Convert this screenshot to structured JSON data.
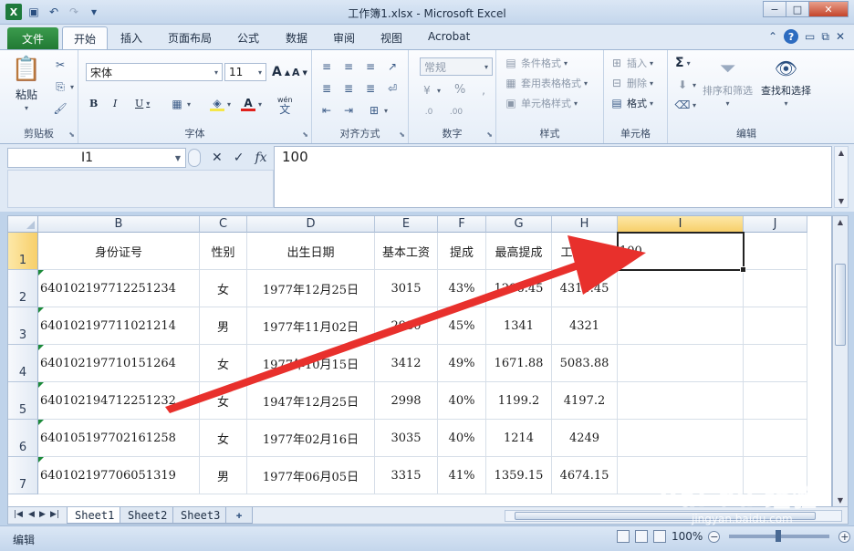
{
  "window": {
    "title": "工作簿1.xlsx - Microsoft Excel",
    "min": "−",
    "max": "□",
    "close": "✕"
  },
  "tabs": {
    "file": "文件",
    "items": [
      "开始",
      "插入",
      "页面布局",
      "公式",
      "数据",
      "审阅",
      "视图",
      "Acrobat"
    ],
    "active": "开始"
  },
  "ribbon": {
    "clipboard": {
      "paste": "粘贴",
      "label": "剪贴板"
    },
    "font": {
      "name": "宋体",
      "size": "11",
      "grow": "A",
      "shrink": "A",
      "bold": "B",
      "italic": "I",
      "underline": "U",
      "wen": "wén",
      "label": "字体"
    },
    "alignment": {
      "label": "对齐方式"
    },
    "number": {
      "format": "常规",
      "percent": "%",
      "label": "数字"
    },
    "styles": {
      "cond": "条件格式",
      "table": "套用表格格式",
      "cell": "单元格样式",
      "label": "样式"
    },
    "cells": {
      "insert": "插入",
      "delete": "删除",
      "format": "格式",
      "label": "单元格"
    },
    "editing": {
      "sum": "Σ",
      "sort": "排序和筛选",
      "find": "查找和选择",
      "label": "编辑"
    }
  },
  "formula_bar": {
    "name_box": "I1",
    "cancel": "✕",
    "enter": "✓",
    "fx": "fx",
    "content": "100"
  },
  "sheet": {
    "columns": [
      "B",
      "C",
      "D",
      "E",
      "F",
      "G",
      "H",
      "I",
      "J"
    ],
    "selected_column": "I",
    "rows": [
      "1",
      "2",
      "3",
      "4",
      "5",
      "6",
      "7"
    ],
    "selected_row": "1",
    "header": [
      "身份证号",
      "性别",
      "出生日期",
      "基本工资",
      "提成",
      "最高提成",
      "工资总额"
    ],
    "active_cell_value": "100",
    "data": [
      [
        "640102197712251234",
        "女",
        "1977年12月25日",
        "3015",
        "43%",
        "1296.45",
        "4311.45"
      ],
      [
        "640102197711021214",
        "男",
        "1977年11月02日",
        "2980",
        "45%",
        "1341",
        "4321"
      ],
      [
        "640102197710151264",
        "女",
        "1977年10月15日",
        "3412",
        "49%",
        "1671.88",
        "5083.88"
      ],
      [
        "640102194712251232",
        "女",
        "1947年12月25日",
        "2998",
        "40%",
        "1199.2",
        "4197.2"
      ],
      [
        "640105197702161258",
        "女",
        "1977年02月16日",
        "3035",
        "40%",
        "1214",
        "4249"
      ],
      [
        "640102197706051319",
        "男",
        "1977年06月05日",
        "3315",
        "41%",
        "1359.15",
        "4674.15"
      ]
    ]
  },
  "sheet_tabs": [
    "Sheet1",
    "Sheet2",
    "Sheet3"
  ],
  "active_sheet": "Sheet1",
  "status": {
    "mode": "编辑",
    "zoom": "100%"
  },
  "watermark": {
    "logo": "Bai du 经验",
    "url": "jingyan.baidu.com"
  },
  "colors": {
    "arrow": "#e8302c",
    "selection": "#f7cf6a",
    "file_tab": "#217a34"
  }
}
